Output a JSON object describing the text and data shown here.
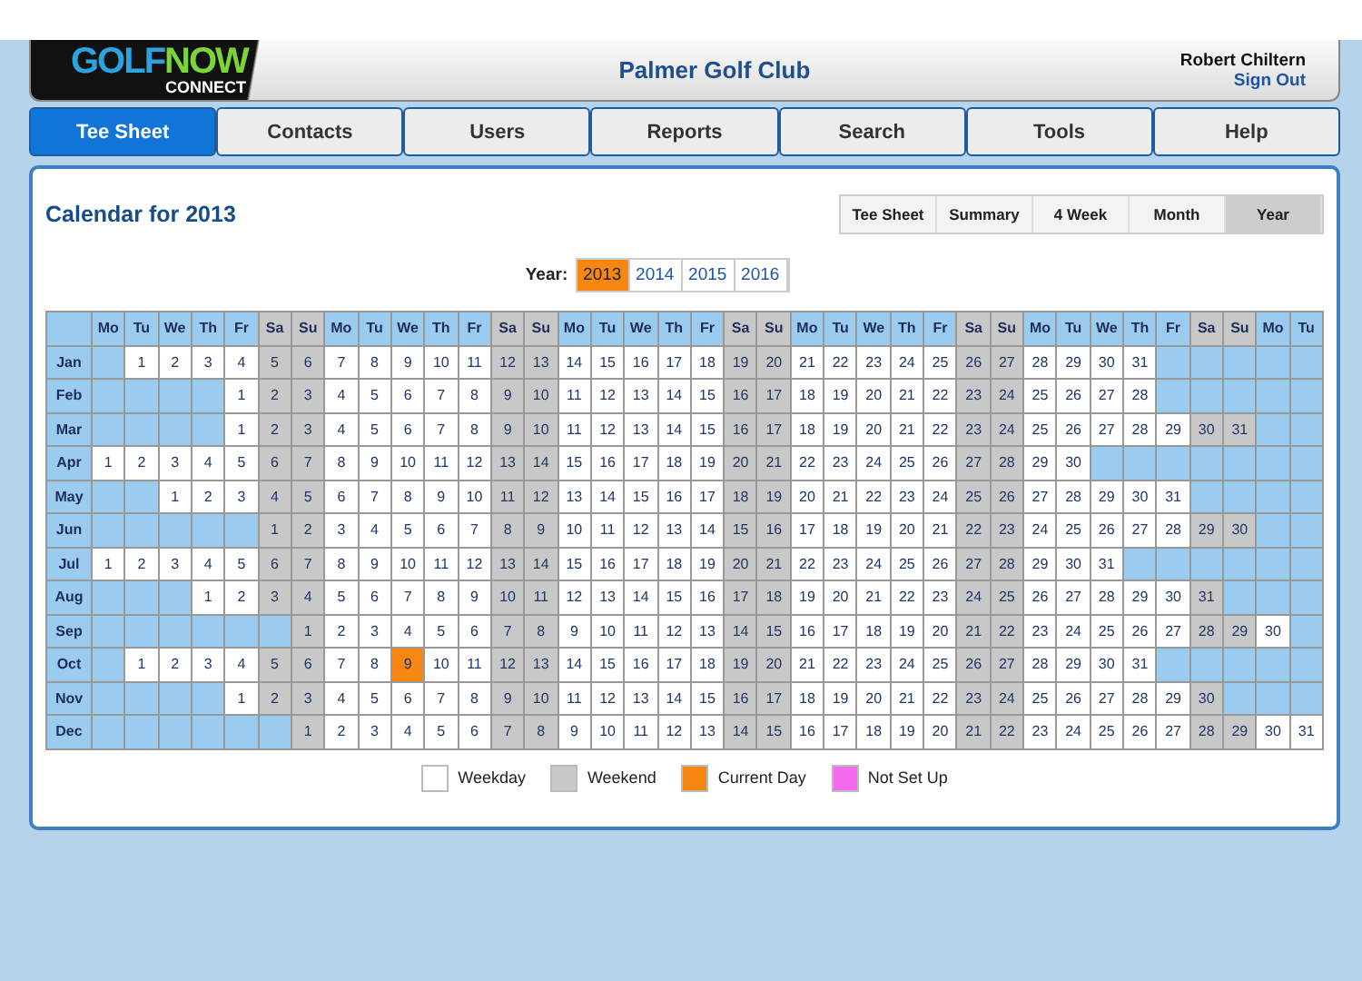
{
  "header": {
    "logo": {
      "first": "GOLF",
      "second": "NOW",
      "sub": "CONNECT"
    },
    "club": "Palmer Golf Club",
    "user": "Robert Chiltern",
    "sign_out": "Sign Out"
  },
  "nav_tabs": [
    {
      "label": "Tee Sheet",
      "selected": true
    },
    {
      "label": "Contacts",
      "selected": false
    },
    {
      "label": "Users",
      "selected": false
    },
    {
      "label": "Reports",
      "selected": false
    },
    {
      "label": "Search",
      "selected": false
    },
    {
      "label": "Tools",
      "selected": false
    },
    {
      "label": "Help",
      "selected": false
    }
  ],
  "calendar": {
    "title": "Calendar for 2013",
    "views": [
      {
        "label": "Tee Sheet",
        "selected": false
      },
      {
        "label": "Summary",
        "selected": false
      },
      {
        "label": "4 Week",
        "selected": false
      },
      {
        "label": "Month",
        "selected": false
      },
      {
        "label": "Year",
        "selected": true
      }
    ],
    "year_label": "Year:",
    "years": [
      {
        "label": "2013",
        "selected": true
      },
      {
        "label": "2014",
        "selected": false
      },
      {
        "label": "2015",
        "selected": false
      },
      {
        "label": "2016",
        "selected": false
      }
    ],
    "weekdays": [
      {
        "label": "Mo",
        "kind": "weekday"
      },
      {
        "label": "Tu",
        "kind": "weekday"
      },
      {
        "label": "We",
        "kind": "weekday"
      },
      {
        "label": "Th",
        "kind": "weekday"
      },
      {
        "label": "Fr",
        "kind": "weekday"
      },
      {
        "label": "Sa",
        "kind": "weekend"
      },
      {
        "label": "Su",
        "kind": "weekend"
      },
      {
        "label": "Mo",
        "kind": "weekday"
      },
      {
        "label": "Tu",
        "kind": "weekday"
      },
      {
        "label": "We",
        "kind": "weekday"
      },
      {
        "label": "Th",
        "kind": "weekday"
      },
      {
        "label": "Fr",
        "kind": "weekday"
      },
      {
        "label": "Sa",
        "kind": "weekend"
      },
      {
        "label": "Su",
        "kind": "weekend"
      },
      {
        "label": "Mo",
        "kind": "weekday"
      },
      {
        "label": "Tu",
        "kind": "weekday"
      },
      {
        "label": "We",
        "kind": "weekday"
      },
      {
        "label": "Th",
        "kind": "weekday"
      },
      {
        "label": "Fr",
        "kind": "weekday"
      },
      {
        "label": "Sa",
        "kind": "weekend"
      },
      {
        "label": "Su",
        "kind": "weekend"
      },
      {
        "label": "Mo",
        "kind": "weekday"
      },
      {
        "label": "Tu",
        "kind": "weekday"
      },
      {
        "label": "We",
        "kind": "weekday"
      },
      {
        "label": "Th",
        "kind": "weekday"
      },
      {
        "label": "Fr",
        "kind": "weekday"
      },
      {
        "label": "Sa",
        "kind": "weekend"
      },
      {
        "label": "Su",
        "kind": "weekend"
      },
      {
        "label": "Mo",
        "kind": "weekday"
      },
      {
        "label": "Tu",
        "kind": "weekday"
      },
      {
        "label": "We",
        "kind": "weekday"
      },
      {
        "label": "Th",
        "kind": "weekday"
      },
      {
        "label": "Fr",
        "kind": "weekday"
      },
      {
        "label": "Sa",
        "kind": "weekend"
      },
      {
        "label": "Su",
        "kind": "weekend"
      },
      {
        "label": "Mo",
        "kind": "weekday"
      },
      {
        "label": "Tu",
        "kind": "weekday"
      }
    ],
    "months": [
      {
        "label": "Jan",
        "days": [
          {
            "kind": "blank"
          },
          "1",
          "2",
          "3",
          "4",
          "5",
          "6",
          "7",
          "8",
          "9",
          "10",
          "11",
          "12",
          "13",
          "14",
          "15",
          "16",
          "17",
          "18",
          "19",
          "20",
          "21",
          "22",
          "23",
          "24",
          "25",
          "26",
          "27",
          "28",
          "29",
          "30",
          "31"
        ]
      },
      {
        "label": "Feb",
        "days": [
          {
            "kind": "blank"
          },
          {
            "kind": "blank"
          },
          {
            "kind": "blank"
          },
          {
            "kind": "blank"
          },
          "1",
          "2",
          "3",
          "4",
          "5",
          "6",
          "7",
          "8",
          "9",
          "10",
          "11",
          "12",
          "13",
          "14",
          "15",
          "16",
          "17",
          "18",
          "19",
          "20",
          "21",
          "22",
          "23",
          "24",
          "25",
          "26",
          "27",
          "28"
        ]
      },
      {
        "label": "Mar",
        "days": [
          {
            "kind": "blank"
          },
          {
            "kind": "blank"
          },
          {
            "kind": "blank"
          },
          {
            "kind": "blank"
          },
          "1",
          "2",
          "3",
          "4",
          "5",
          "6",
          "7",
          "8",
          "9",
          "10",
          "11",
          "12",
          "13",
          "14",
          "15",
          "16",
          "17",
          "18",
          "19",
          "20",
          "21",
          "22",
          "23",
          "24",
          "25",
          "26",
          "27",
          "28",
          "29",
          "30",
          "31"
        ]
      },
      {
        "label": "Apr",
        "days": [
          "1",
          "2",
          "3",
          "4",
          "5",
          "6",
          "7",
          "8",
          "9",
          "10",
          "11",
          "12",
          "13",
          "14",
          "15",
          "16",
          "17",
          "18",
          "19",
          "20",
          "21",
          "22",
          "23",
          "24",
          "25",
          "26",
          "27",
          "28",
          "29",
          "30"
        ]
      },
      {
        "label": "May",
        "days": [
          {
            "kind": "blank"
          },
          {
            "kind": "blank"
          },
          "1",
          "2",
          "3",
          "4",
          "5",
          "6",
          "7",
          "8",
          "9",
          "10",
          "11",
          "12",
          "13",
          "14",
          "15",
          "16",
          "17",
          "18",
          "19",
          "20",
          "21",
          "22",
          "23",
          "24",
          "25",
          "26",
          "27",
          "28",
          "29",
          "30",
          "31"
        ]
      },
      {
        "label": "Jun",
        "days": [
          {
            "kind": "blank"
          },
          {
            "kind": "blank"
          },
          {
            "kind": "blank"
          },
          {
            "kind": "blank"
          },
          {
            "kind": "blank"
          },
          "1",
          "2",
          "3",
          "4",
          "5",
          "6",
          "7",
          "8",
          "9",
          "10",
          "11",
          "12",
          "13",
          "14",
          "15",
          "16",
          "17",
          "18",
          "19",
          "20",
          "21",
          "22",
          "23",
          "24",
          "25",
          "26",
          "27",
          "28",
          "29",
          "30"
        ]
      },
      {
        "label": "Jul",
        "days": [
          "1",
          "2",
          "3",
          "4",
          "5",
          "6",
          "7",
          "8",
          "9",
          "10",
          "11",
          "12",
          "13",
          "14",
          "15",
          "16",
          "17",
          "18",
          "19",
          "20",
          "21",
          "22",
          "23",
          "24",
          "25",
          "26",
          "27",
          "28",
          "29",
          "30",
          "31"
        ]
      },
      {
        "label": "Aug",
        "days": [
          {
            "kind": "blank"
          },
          {
            "kind": "blank"
          },
          {
            "kind": "blank"
          },
          "1",
          "2",
          "3",
          "4",
          "5",
          "6",
          "7",
          "8",
          "9",
          "10",
          "11",
          "12",
          "13",
          "14",
          "15",
          "16",
          "17",
          "18",
          "19",
          "20",
          "21",
          "22",
          "23",
          "24",
          "25",
          "26",
          "27",
          "28",
          "29",
          "30",
          "31"
        ]
      },
      {
        "label": "Sep",
        "days": [
          {
            "kind": "blank"
          },
          {
            "kind": "blank"
          },
          {
            "kind": "blank"
          },
          {
            "kind": "blank"
          },
          {
            "kind": "blank"
          },
          {
            "kind": "blank"
          },
          "1",
          "2",
          "3",
          "4",
          "5",
          "6",
          "7",
          "8",
          "9",
          "10",
          "11",
          "12",
          "13",
          "14",
          "15",
          "16",
          "17",
          "18",
          "19",
          "20",
          "21",
          "22",
          "23",
          "24",
          "25",
          "26",
          "27",
          "28",
          "29",
          "30"
        ]
      },
      {
        "label": "Oct",
        "days": [
          {
            "kind": "blank"
          },
          "1",
          "2",
          "3",
          "4",
          "5",
          "6",
          "7",
          "8",
          {
            "day": "9",
            "kind": "current"
          },
          "10",
          "11",
          "12",
          "13",
          "14",
          "15",
          "16",
          "17",
          "18",
          "19",
          "20",
          "21",
          "22",
          "23",
          "24",
          "25",
          "26",
          "27",
          "28",
          "29",
          "30",
          "31"
        ]
      },
      {
        "label": "Nov",
        "days": [
          {
            "kind": "blank"
          },
          {
            "kind": "blank"
          },
          {
            "kind": "blank"
          },
          {
            "kind": "blank"
          },
          "1",
          "2",
          "3",
          "4",
          "5",
          "6",
          "7",
          "8",
          "9",
          "10",
          "11",
          "12",
          "13",
          "14",
          "15",
          "16",
          "17",
          "18",
          "19",
          "20",
          "21",
          "22",
          "23",
          "24",
          "25",
          "26",
          "27",
          "28",
          "29",
          "30"
        ]
      },
      {
        "label": "Dec",
        "days": [
          {
            "kind": "blank"
          },
          {
            "kind": "blank"
          },
          {
            "kind": "blank"
          },
          {
            "kind": "blank"
          },
          {
            "kind": "blank"
          },
          {
            "kind": "blank"
          },
          "1",
          "2",
          "3",
          "4",
          "5",
          "6",
          "7",
          "8",
          "9",
          "10",
          "11",
          "12",
          "13",
          "14",
          "15",
          "16",
          "17",
          "18",
          "19",
          "20",
          "21",
          "22",
          "23",
          "24",
          "25",
          "26",
          "27",
          "28",
          "29",
          "30",
          "31"
        ]
      }
    ],
    "legend": [
      {
        "label": "Weekday",
        "color": "#ffffff"
      },
      {
        "label": "Weekend",
        "color": "#c8c8c8"
      },
      {
        "label": "Current Day",
        "color": "#f7870f"
      },
      {
        "label": "Not Set Up",
        "color": "#f56af0"
      }
    ]
  }
}
